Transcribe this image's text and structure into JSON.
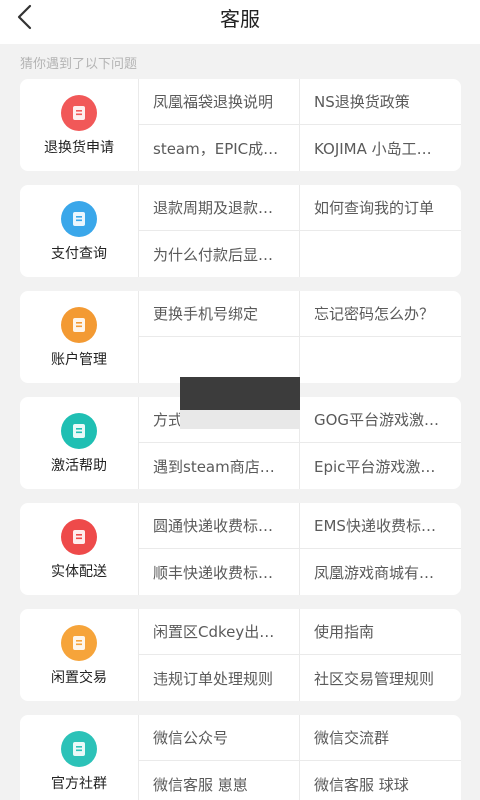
{
  "header": {
    "title": "客服"
  },
  "hint": "猜你遇到了以下问题",
  "categories": [
    {
      "label": "退换货申请",
      "icon": "return-icon",
      "color": "#f15858",
      "questions": [
        "凤凰福袋退换说明",
        "NS退换货政策",
        "steam，EPIC成…",
        "KOJIMA 小岛工…"
      ]
    },
    {
      "label": "支付查询",
      "icon": "payment-search-icon",
      "color": "#3aa7ea",
      "questions": [
        "退款周期及退款…",
        "如何查询我的订单",
        "为什么付款后显…",
        ""
      ]
    },
    {
      "label": "账户管理",
      "icon": "account-icon",
      "color": "#f39a33",
      "questions": [
        "更换手机号绑定",
        "忘记密码怎么办？",
        "",
        ""
      ]
    },
    {
      "label": "激活帮助",
      "icon": "activation-icon",
      "color": "#1fbfb3",
      "questions": [
        "方式",
        "GOG平台游戏激…",
        "遇到steam商店…",
        "Epic平台游戏激…"
      ]
    },
    {
      "label": "实体配送",
      "icon": "delivery-icon",
      "color": "#ee4a4a",
      "questions": [
        "圆通快递收费标…",
        "EMS快递收费标…",
        "顺丰快递收费标…",
        "凤凰游戏商城有…"
      ]
    },
    {
      "label": "闲置交易",
      "icon": "trade-icon",
      "color": "#f6a43a",
      "questions": [
        " 闲置区Cdkey出…",
        "使用指南",
        "违规订单处理规则",
        "社区交易管理规则"
      ]
    },
    {
      "label": "官方社群",
      "icon": "community-icon",
      "color": "#2cc2b8",
      "questions": [
        "微信公众号",
        "微信交流群",
        "微信客服 崽崽",
        "微信客服 球球"
      ]
    }
  ]
}
